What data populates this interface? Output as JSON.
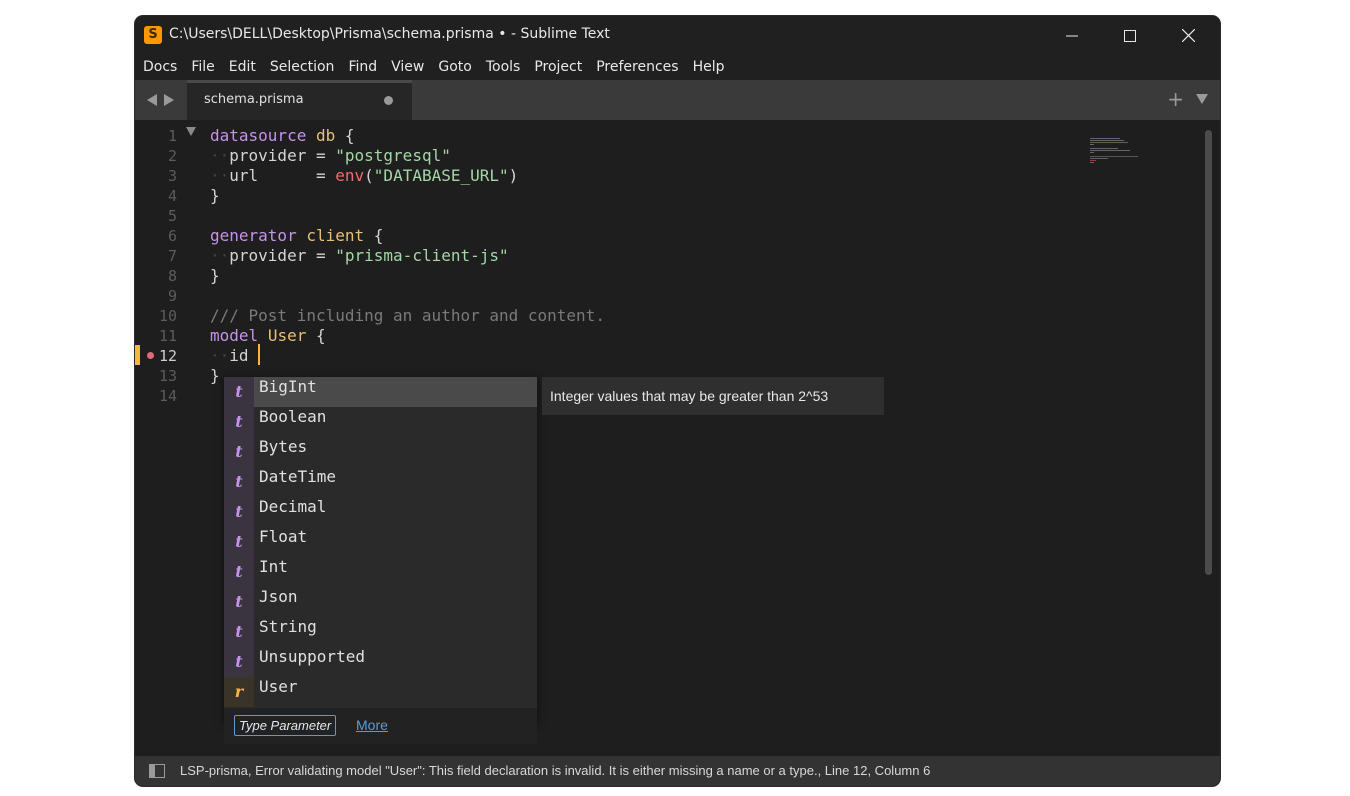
{
  "window": {
    "title": "C:\\Users\\DELL\\Desktop\\Prisma\\schema.prisma • - Sublime Text",
    "app_icon_glyph": "S",
    "accent_color": "#5b9bd5",
    "icon_color": "#ff9800"
  },
  "menu": {
    "items": [
      "Docs",
      "File",
      "Edit",
      "Selection",
      "Find",
      "View",
      "Goto",
      "Tools",
      "Project",
      "Preferences",
      "Help"
    ],
    "active": "File"
  },
  "tabs": {
    "items": [
      {
        "label": "schema.prisma",
        "dirty": true
      }
    ],
    "plus_icon": "+"
  },
  "editor": {
    "line_numbers": [
      "1",
      "2",
      "3",
      "4",
      "5",
      "6",
      "7",
      "8",
      "9",
      "10",
      "11",
      "12",
      "13",
      "14"
    ],
    "current_line": "12",
    "lines": {
      "l1": {
        "kw": "datasource",
        "name": "db",
        "brace": "{"
      },
      "l2": {
        "ws": "··",
        "key": "provider",
        "op": "=",
        "value": "\"postgresql\""
      },
      "l3": {
        "ws": "··",
        "key": "url",
        "op": "=",
        "fn": "env",
        "open": "(",
        "arg": "\"DATABASE_URL\"",
        "close": ")"
      },
      "l4": {
        "brace": "}"
      },
      "l6": {
        "kw": "generator",
        "name": "client",
        "brace": "{"
      },
      "l7": {
        "ws": "··",
        "key": "provider",
        "op": "=",
        "value": "\"prisma-client-js\""
      },
      "l8": {
        "brace": "}"
      },
      "l10": {
        "comment": "/// Post including an author and content."
      },
      "l11": {
        "kw": "model",
        "name": "User",
        "brace": "{"
      },
      "l12": {
        "ws": "··",
        "key": "id"
      },
      "l13": {
        "brace": "}"
      }
    }
  },
  "autocomplete": {
    "items": [
      {
        "kind": "t",
        "label": "BigInt"
      },
      {
        "kind": "t",
        "label": "Boolean"
      },
      {
        "kind": "t",
        "label": "Bytes"
      },
      {
        "kind": "t",
        "label": "DateTime"
      },
      {
        "kind": "t",
        "label": "Decimal"
      },
      {
        "kind": "t",
        "label": "Float"
      },
      {
        "kind": "t",
        "label": "Int"
      },
      {
        "kind": "t",
        "label": "Json"
      },
      {
        "kind": "t",
        "label": "String"
      },
      {
        "kind": "t",
        "label": "Unsupported"
      },
      {
        "kind": "r",
        "label": "User"
      }
    ],
    "selected": "BigInt",
    "kind_label": "Type Parameter",
    "more_link": "More",
    "doc": "Integer values that may be greater than 2^53"
  },
  "status": {
    "text": "LSP-prisma, Error validating model \"User\": This field declaration is invalid. It is either missing a name or a type., Line 12, Column 6"
  },
  "icons": {
    "minimize": "minimize-icon",
    "maximize": "maximize-icon",
    "close": "close-icon",
    "nav_back": "arrow-left-icon",
    "nav_forward": "arrow-right-icon",
    "new_tab": "plus-icon",
    "tab_menu": "chevron-down-icon",
    "fold": "fold-triangle-icon",
    "sidebar": "sidebar-toggle-icon"
  }
}
